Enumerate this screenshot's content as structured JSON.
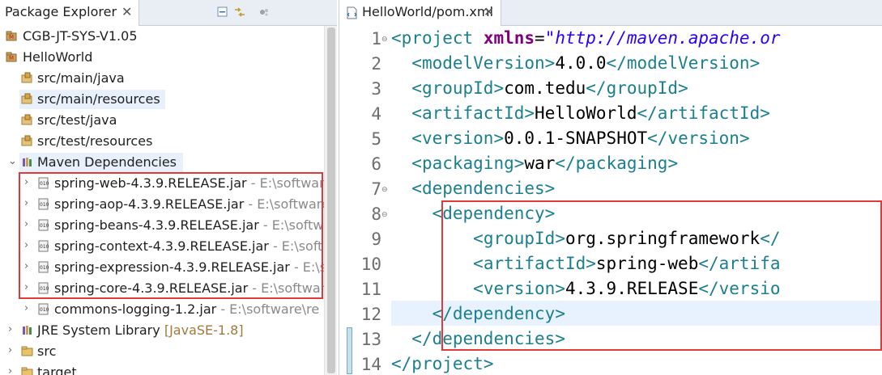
{
  "package_explorer": {
    "title": "Package Explorer",
    "close": "✕",
    "toolbar_icons": [
      "collapse-all-icon",
      "link-with-editor-icon",
      "view-menu-icon"
    ],
    "tree": [
      {
        "label": "CGB-JT-SYS-V1.05",
        "kind": "project"
      },
      {
        "label": "HelloWorld",
        "kind": "project"
      },
      {
        "label": "src/main/java",
        "kind": "source-folder"
      },
      {
        "label": "src/main/resources",
        "kind": "source-folder"
      },
      {
        "label": "src/test/java",
        "kind": "source-folder"
      },
      {
        "label": "src/test/resources",
        "kind": "source-folder"
      },
      {
        "label": "Maven Dependencies",
        "kind": "library"
      },
      {
        "label": "spring-web-4.3.9.RELEASE.jar",
        "path": "- E:\\software",
        "kind": "jar"
      },
      {
        "label": "spring-aop-4.3.9.RELEASE.jar",
        "path": "- E:\\software",
        "kind": "jar"
      },
      {
        "label": "spring-beans-4.3.9.RELEASE.jar",
        "path": "- E:\\softw",
        "kind": "jar"
      },
      {
        "label": "spring-context-4.3.9.RELEASE.jar",
        "path": "- E:\\soft",
        "kind": "jar"
      },
      {
        "label": "spring-expression-4.3.9.RELEASE.jar",
        "path": "- E:\\s",
        "kind": "jar"
      },
      {
        "label": "spring-core-4.3.9.RELEASE.jar",
        "path": "- E:\\software",
        "kind": "jar"
      },
      {
        "label": "commons-logging-1.2.jar",
        "path": "- E:\\software\\re",
        "kind": "jar"
      },
      {
        "label": "JRE System Library",
        "version": "[JavaSE-1.8]",
        "kind": "library"
      },
      {
        "label": "src",
        "kind": "folder"
      },
      {
        "label": "target",
        "kind": "folder"
      }
    ]
  },
  "editor": {
    "tab_title": "HelloWorld/pom.xml",
    "close": "✕",
    "line_numbers": [
      "1",
      "2",
      "3",
      "4",
      "5",
      "6",
      "7",
      "8",
      "9",
      "10",
      "11",
      "12",
      "13",
      "14"
    ],
    "fold_marker": "⊖",
    "lines": {
      "l1_tag": "project",
      "l1_attr": "xmlns",
      "l1_val": "\"http://maven.apache.or",
      "l2_tag": "modelVersion",
      "l2_val": "4.0.0",
      "l3_tag": "groupId",
      "l3_val": "com.tedu",
      "l4_tag": "artifactId",
      "l4_val": "HelloWorld",
      "l5_tag": "version",
      "l5_val": "0.0.1-SNAPSHOT",
      "l6_tag": "packaging",
      "l6_val": "war",
      "l7_tag": "dependencies",
      "l8_tag": "dependency",
      "l9_tag": "groupId",
      "l9_val": "org.springframework",
      "l9_tail": "</",
      "l10_tag": "artifactId",
      "l10_val": "spring-web",
      "l10_tail": "</artifa",
      "l11_tag": "version",
      "l11_val": "4.3.9.RELEASE",
      "l11_tail": "</versio",
      "l12_tag": "dependency",
      "l13_tag": "dependencies",
      "l14_tag": "project"
    }
  },
  "colors": {
    "annotation_red": "#e03a3a",
    "xml_tag": "#1a7f8e",
    "selection": "#e8f1fb"
  }
}
